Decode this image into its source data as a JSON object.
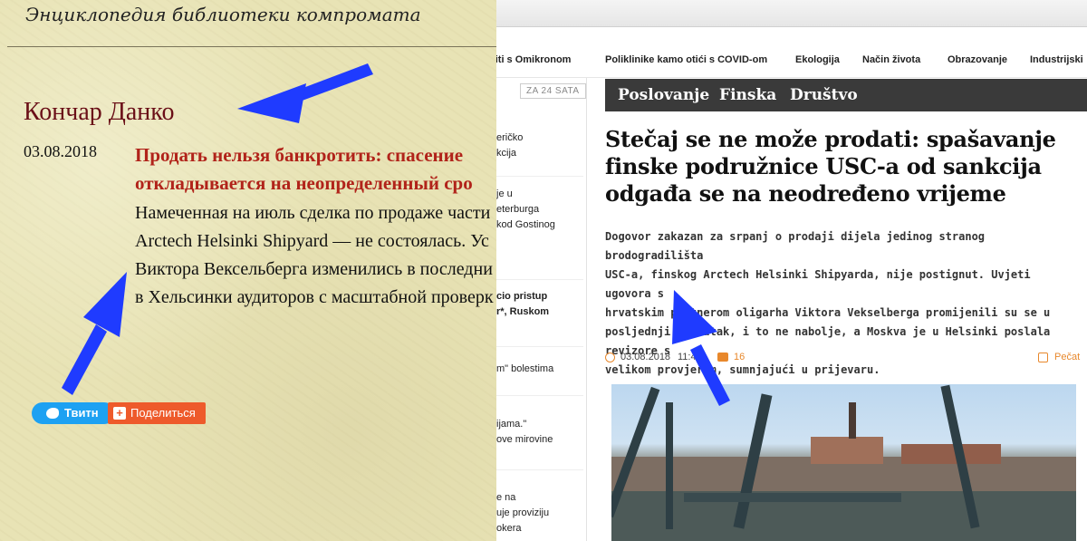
{
  "left_page": {
    "site_title": "Энциклопедия библиотеки компромата",
    "person_name": "Кончар Данко",
    "date": "03.08.2018",
    "headline_lines": [
      "Продать нельзя банкротить: спасение",
      "откладывается на неопределенный сро"
    ],
    "body_lines": [
      "Намеченная на июль сделка по продаже части",
      "Arctech Helsinki Shipyard — не состоялась. Ус",
      "Виктора Вексельберга изменились в последни",
      "в Хельсинки аудиторов с масштабной проверк"
    ],
    "tweet_label": "Твитн",
    "share_label": "Поделиться"
  },
  "right_page": {
    "top_nav": [
      "niti s Omikronom",
      "Poliklinike kamo otići s COVID-om",
      "Ekologija",
      "Način života",
      "Obrazovanje",
      "Industrijski"
    ],
    "za24_label": "ZA 24 SATA",
    "news_items": [
      {
        "lines": [
          "eričko",
          "kcija"
        ],
        "bold": false
      },
      {
        "lines": [
          "je u",
          "eterburga",
          "kod Gostinog"
        ],
        "bold": false
      },
      {
        "lines": [
          "cio pristup",
          "r*, Ruskom"
        ],
        "bold": true
      },
      {
        "lines": [
          "m\" bolestima"
        ],
        "bold": false
      },
      {
        "lines": [
          "ijama.\"",
          "ove mirovine"
        ],
        "bold": false
      },
      {
        "lines": [
          "e na",
          "uje proviziju",
          "okera"
        ],
        "bold": false
      }
    ],
    "categories": [
      "Poslovanje",
      "Finska",
      "Društvo"
    ],
    "title_lines": [
      "Stečaj se ne može prodati: spašavanje",
      "finske podružnice USC-a od sankcija",
      "odgađa se na neodređeno vrijeme"
    ],
    "lead_lines": [
      "Dogovor zakazan za srpanj o prodaji dijela jedinog stranog brodogradilišta",
      "USC-a, finskog Arctech Helsinki Shipyarda, nije postignut. Uvjeti ugovora s",
      "hrvatskim partnerom oligarha Viktora Vekselberga promijenili su se u",
      "posljednji trenutak, i to ne nabolje, a Moskva je u Helsinki poslala revizore s",
      "velikom provjerom, sumnjajući u prijevaru."
    ],
    "meta": {
      "date": "03.08.2018",
      "time": "11:47",
      "comments": "16",
      "print_label": "Pečat"
    }
  },
  "colors": {
    "parchment": "#e8e3b5",
    "person_name": "#6a0f17",
    "headline_red": "#b1231a",
    "category_bar": "#3a3a3a",
    "accent_orange": "#e8882c",
    "arrow_blue": "#1f3bff",
    "tweet_blue": "#1da1f2",
    "share_orange": "#ee5a2b"
  }
}
